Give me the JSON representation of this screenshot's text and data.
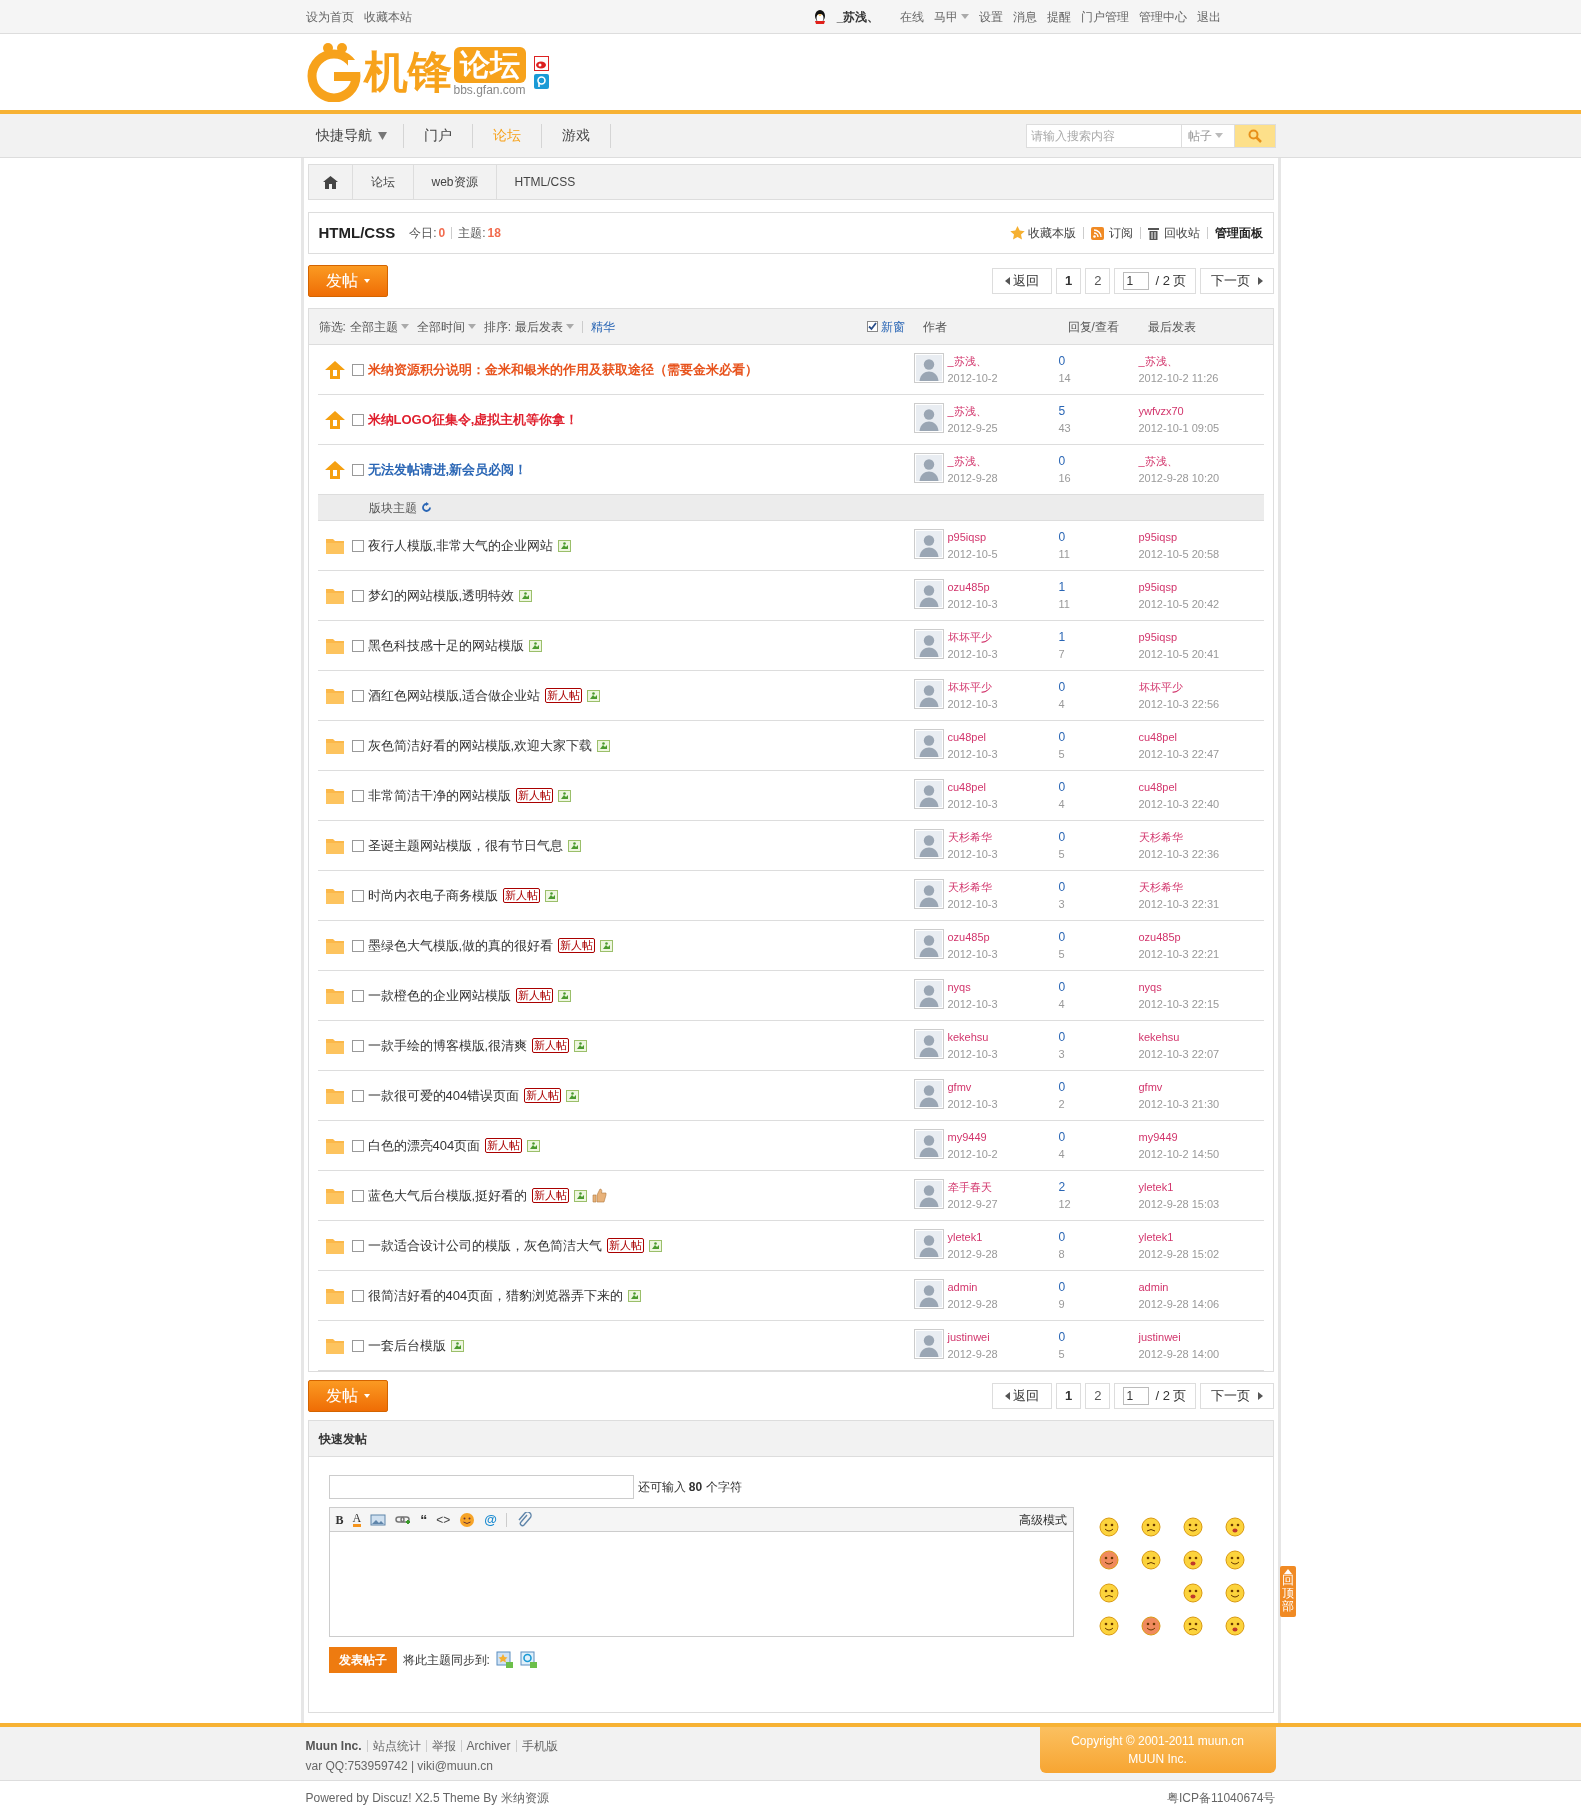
{
  "topbar": {
    "left_links": [
      "设为首页",
      "收藏本站"
    ],
    "user": "_苏浅、",
    "links": [
      {
        "label": "在线",
        "dropdown": false
      },
      {
        "label": "马甲",
        "dropdown": true
      },
      {
        "label": "设置",
        "dropdown": false
      },
      {
        "label": "消息",
        "dropdown": false
      },
      {
        "label": "提醒",
        "dropdown": false
      },
      {
        "label": "门户管理",
        "dropdown": false
      },
      {
        "label": "管理中心",
        "dropdown": false
      },
      {
        "label": "退出",
        "dropdown": false
      }
    ]
  },
  "logo": {
    "name": "机锋",
    "badge": "论坛",
    "domain": "bbs.gfan.com"
  },
  "nav": {
    "items": [
      {
        "label": "快捷导航",
        "dropdown": true,
        "selected": false
      },
      {
        "label": "门户",
        "dropdown": false,
        "selected": false
      },
      {
        "label": "论坛",
        "dropdown": false,
        "selected": true
      },
      {
        "label": "游戏",
        "dropdown": false,
        "selected": false
      }
    ],
    "search": {
      "placeholder": "请输入搜索内容",
      "type": "帖子"
    }
  },
  "breadcrumb": [
    "论坛",
    "web资源",
    "HTML/CSS"
  ],
  "forum": {
    "title": "HTML/CSS",
    "today_label": "今日:",
    "today": "0",
    "topics_label": "主题:",
    "topics": "18",
    "actions": [
      {
        "label": "收藏本版",
        "kind": "star"
      },
      {
        "label": "订阅",
        "kind": "rss"
      },
      {
        "label": "回收站",
        "kind": "trash"
      },
      {
        "label": "管理面板",
        "kind": "text"
      }
    ]
  },
  "post_button": "发帖",
  "pager": {
    "back": "返回",
    "pages": [
      {
        "label": "1",
        "selected": true
      },
      {
        "label": "2",
        "selected": false
      }
    ],
    "input": "1",
    "total": "/ 2 页",
    "next": "下一页"
  },
  "bottom_post_button": "发帖",
  "bottom_pager": {
    "back": "返回",
    "pages": [
      {
        "label": "1",
        "selected": true
      },
      {
        "label": "2",
        "selected": false
      }
    ],
    "input": "1",
    "total": "/ 2 页",
    "next": "下一页"
  },
  "filters": {
    "label": "筛选:",
    "options": [
      "全部主题",
      "全部时间"
    ],
    "sort_label": "排序:",
    "sort": "最后发表",
    "digest": "精华",
    "new_window": {
      "label": "新窗",
      "checked": true
    },
    "columns": [
      "作者",
      "回复/查看",
      "最后发表"
    ]
  },
  "sticky": [
    {
      "title": "米纳资源积分说明：金米和银米的作用及获取途径（需要金米必看）",
      "color": "#e8541e",
      "checked": false,
      "author": "_苏浅、",
      "date": "2012-10-2",
      "replies": "0",
      "views": "14",
      "last_user": "_苏浅、",
      "last_time": "2012-10-2 11:26"
    },
    {
      "title": "米纳LOGO征集令,虚拟主机等你拿！",
      "color": "#e0202e",
      "checked": false,
      "author": "_苏浅、",
      "date": "2012-9-25",
      "replies": "5",
      "views": "43",
      "last_user": "ywfvzx70",
      "last_time": "2012-10-1 09:05"
    },
    {
      "title": "无法发帖请进,新会员必阅！",
      "color": "#2a66b5",
      "checked": false,
      "author": "_苏浅、",
      "date": "2012-9-28",
      "replies": "0",
      "views": "16",
      "last_user": "_苏浅、",
      "last_time": "2012-9-28 10:20"
    }
  ],
  "section_label": "版块主题",
  "threads": [
    {
      "title": "夜行人模版,非常大气的企业网站",
      "checked": false,
      "liked": false,
      "author": "p95iqsp",
      "date": "2012-10-5",
      "replies": "0",
      "views": "11",
      "last_user": "p95iqsp",
      "last_time": "2012-10-5 20:58"
    },
    {
      "title": "梦幻的网站模版,透明特效",
      "checked": false,
      "liked": false,
      "author": "ozu485p",
      "date": "2012-10-3",
      "replies": "1",
      "views": "11",
      "last_user": "p95iqsp",
      "last_time": "2012-10-5 20:42"
    },
    {
      "title": "黑色科技感十足的网站模版",
      "checked": false,
      "liked": false,
      "author": "坏坏平少",
      "date": "2012-10-3",
      "replies": "1",
      "views": "7",
      "last_user": "p95iqsp",
      "last_time": "2012-10-5 20:41"
    },
    {
      "title": "酒红色网站模版,适合做企业站",
      "badge": "新人帖",
      "checked": false,
      "liked": false,
      "author": "坏坏平少",
      "date": "2012-10-3",
      "replies": "0",
      "views": "4",
      "last_user": "坏坏平少",
      "last_time": "2012-10-3 22:56"
    },
    {
      "title": "灰色简洁好看的网站模版,欢迎大家下载",
      "checked": false,
      "liked": false,
      "author": "cu48pel",
      "date": "2012-10-3",
      "replies": "0",
      "views": "5",
      "last_user": "cu48pel",
      "last_time": "2012-10-3 22:47"
    },
    {
      "title": "非常简洁干净的网站模版",
      "badge": "新人帖",
      "checked": false,
      "liked": false,
      "author": "cu48pel",
      "date": "2012-10-3",
      "replies": "0",
      "views": "4",
      "last_user": "cu48pel",
      "last_time": "2012-10-3 22:40"
    },
    {
      "title": "圣诞主题网站模版，很有节日气息",
      "checked": false,
      "liked": false,
      "author": "天杉希华",
      "date": "2012-10-3",
      "replies": "0",
      "views": "5",
      "last_user": "天杉希华",
      "last_time": "2012-10-3 22:36"
    },
    {
      "title": "时尚内衣电子商务模版",
      "badge": "新人帖",
      "checked": false,
      "liked": false,
      "author": "天杉希华",
      "date": "2012-10-3",
      "replies": "0",
      "views": "3",
      "last_user": "天杉希华",
      "last_time": "2012-10-3 22:31"
    },
    {
      "title": "墨绿色大气模版,做的真的很好看",
      "badge": "新人帖",
      "checked": false,
      "liked": false,
      "author": "ozu485p",
      "date": "2012-10-3",
      "replies": "0",
      "views": "5",
      "last_user": "ozu485p",
      "last_time": "2012-10-3 22:21"
    },
    {
      "title": "一款橙色的企业网站模版",
      "badge": "新人帖",
      "checked": false,
      "liked": false,
      "author": "nyqs",
      "date": "2012-10-3",
      "replies": "0",
      "views": "4",
      "last_user": "nyqs",
      "last_time": "2012-10-3 22:15"
    },
    {
      "title": "一款手绘的博客模版,很清爽",
      "badge": "新人帖",
      "checked": false,
      "liked": false,
      "author": "kekehsu",
      "date": "2012-10-3",
      "replies": "0",
      "views": "3",
      "last_user": "kekehsu",
      "last_time": "2012-10-3 22:07"
    },
    {
      "title": "一款很可爱的404错误页面",
      "badge": "新人帖",
      "checked": false,
      "liked": false,
      "author": "gfmv",
      "date": "2012-10-3",
      "replies": "0",
      "views": "2",
      "last_user": "gfmv",
      "last_time": "2012-10-3 21:30"
    },
    {
      "title": "白色的漂亮404页面",
      "badge": "新人帖",
      "checked": false,
      "liked": false,
      "author": "my9449",
      "date": "2012-10-2",
      "replies": "0",
      "views": "4",
      "last_user": "my9449",
      "last_time": "2012-10-2 14:50"
    },
    {
      "title": "蓝色大气后台模版,挺好看的",
      "badge": "新人帖",
      "checked": false,
      "liked": true,
      "author": "牵手春天",
      "date": "2012-9-27",
      "replies": "2",
      "views": "12",
      "last_user": "yletek1",
      "last_time": "2012-9-28 15:03"
    },
    {
      "title": "一款适合设计公司的模版，灰色简洁大气",
      "badge": "新人帖",
      "checked": false,
      "liked": false,
      "author": "yletek1",
      "date": "2012-9-28",
      "replies": "0",
      "views": "8",
      "last_user": "yletek1",
      "last_time": "2012-9-28 15:02"
    },
    {
      "title": "很简洁好看的404页面，猎豹浏览器弄下来的",
      "checked": false,
      "liked": false,
      "author": "admin",
      "date": "2012-9-28",
      "replies": "0",
      "views": "9",
      "last_user": "admin",
      "last_time": "2012-9-28 14:06"
    },
    {
      "title": "一套后台模版",
      "checked": false,
      "liked": false,
      "author": "justinwei",
      "date": "2012-9-28",
      "replies": "0",
      "views": "5",
      "last_user": "justinwei",
      "last_time": "2012-9-28 14:00"
    }
  ],
  "quick_post": {
    "title": "快速发帖",
    "counter": "还可输入 **80** 个字符",
    "toolbar": [
      {
        "kind": "bold",
        "label": "B"
      },
      {
        "kind": "color",
        "label": "A"
      },
      {
        "kind": "image"
      },
      {
        "kind": "link"
      },
      {
        "kind": "quote",
        "label": "“"
      },
      {
        "kind": "code",
        "label": "<>"
      },
      {
        "kind": "smiley"
      },
      {
        "kind": "at",
        "label": "@"
      },
      {
        "kind": "attach"
      }
    ],
    "advanced": "高级模式",
    "submit": "发表帖子",
    "sync_label": "将此主题同步到:"
  },
  "back_to_top": "回顶部",
  "footer": {
    "company": "Muun Inc.",
    "links": [
      "站点统计",
      "举报",
      "Archiver",
      "手机版"
    ],
    "contact": "var QQ:753959742 | viki@muun.cn",
    "copyright": [
      "Copyright © 2001-2011 muun.cn",
      "MUUN Inc."
    ],
    "powered": "Powered by Discuz! X2.5 Theme By 米纳资源",
    "icp": "粤ICP备11040674号"
  }
}
